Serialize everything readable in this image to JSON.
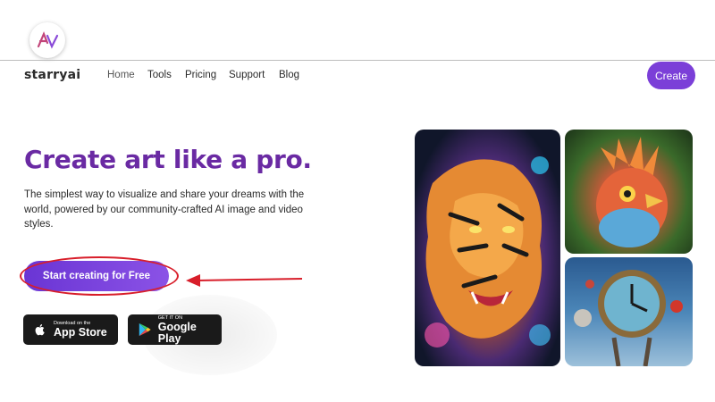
{
  "header": {
    "brand": "starryai",
    "nav": [
      {
        "label": "Home"
      },
      {
        "label": "Tools"
      },
      {
        "label": "Pricing"
      },
      {
        "label": "Support"
      },
      {
        "label": "Blog"
      }
    ],
    "create_label": "Create"
  },
  "hero": {
    "title": "Create art like a pro.",
    "subtitle": "The simplest way to visualize and share your dreams with the world, powered by our community-crafted AI image and video styles.",
    "cta_label": "Start creating for Free"
  },
  "stores": {
    "apple": {
      "small": "Download on the",
      "big": "App Store"
    },
    "google": {
      "small": "GET IT ON",
      "big": "Google Play"
    }
  },
  "gallery": [
    {
      "icon": "tiger-art-image"
    },
    {
      "icon": "bird-art-image"
    },
    {
      "icon": "clock-art-image"
    }
  ],
  "colors": {
    "accent": "#7b3fd8",
    "title": "#6a2aa3",
    "annotation": "#d81e2a"
  }
}
